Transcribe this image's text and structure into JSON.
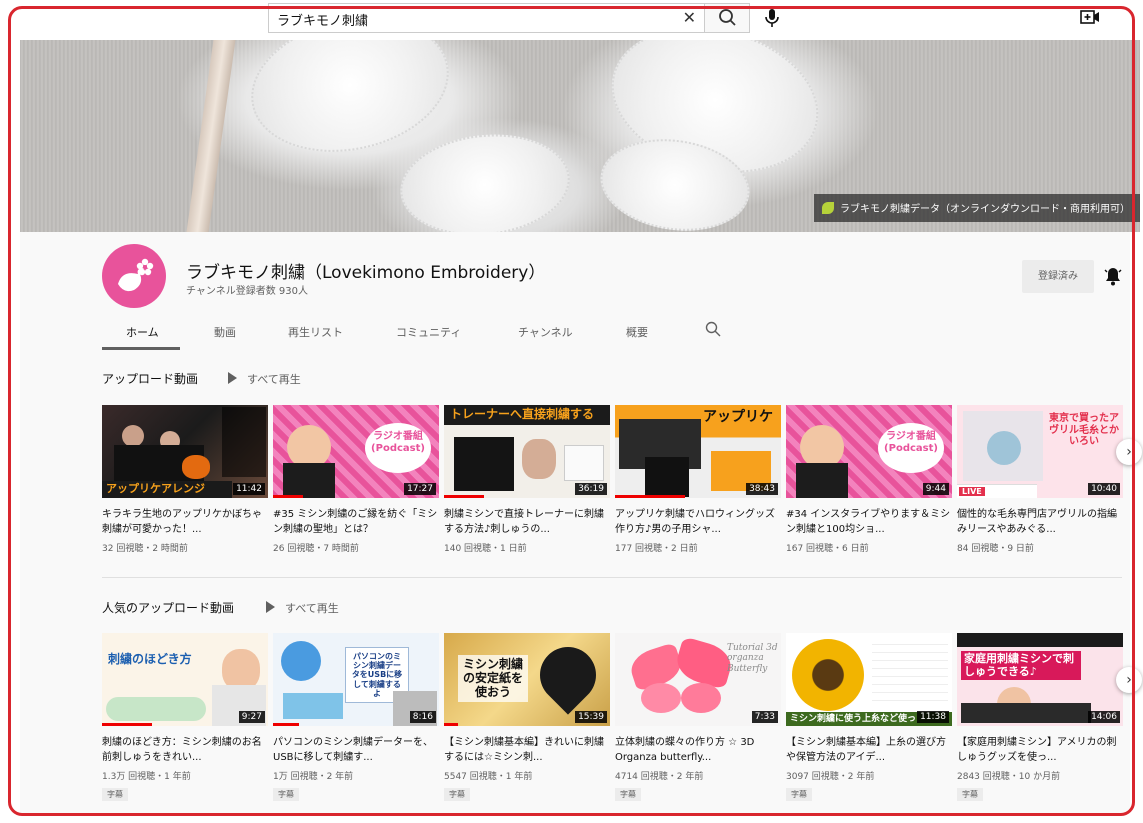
{
  "search": {
    "value": "ラブキモノ刺繍",
    "clear_icon": "close-icon",
    "search_icon": "search-icon",
    "mic_icon": "mic-icon",
    "create_icon": "video-add-icon"
  },
  "banner": {
    "link_text": "ラブキモノ刺繍データ（オンラインダウンロード・商用利用可）"
  },
  "channel": {
    "name": "ラブキモノ刺繍（Lovekimono Embroidery）",
    "subscribers": "チャンネル登録者数 930人",
    "subscribe_label": "登録済み",
    "avatar_color": "#e8539b"
  },
  "tabs": [
    {
      "label": "ホーム",
      "active": true
    },
    {
      "label": "動画"
    },
    {
      "label": "再生リスト"
    },
    {
      "label": "コミュニティ"
    },
    {
      "label": "チャンネル"
    },
    {
      "label": "概要"
    }
  ],
  "shelves": [
    {
      "title": "アップロード動画",
      "play_all": "すべて再生",
      "videos": [
        {
          "title": "キラキラ生地のアップリケかぼちゃ刺繍が可愛かった！...",
          "meta": "32 回視聴・2 時間前",
          "duration": "11:42",
          "caption": "アップリケアレンジ"
        },
        {
          "title": "#35 ミシン刺繍のご縁を紡ぐ「ミシン刺繍の聖地」とは？",
          "meta": "26 回視聴・7 時間前",
          "duration": "17:27",
          "caption": "ラジオ番組(Podcast)"
        },
        {
          "title": "刺繍ミシンで直接トレーナーに刺繍する方法♪刺しゅうの...",
          "meta": "140 回視聴・1 日前",
          "duration": "36:19",
          "caption": "トレーナーへ直接刺繍する"
        },
        {
          "title": "アップリケ刺繍でハロウィングッズ作り方♪男の子用シャ...",
          "meta": "177 回視聴・2 日前",
          "duration": "38:43",
          "caption": "アップリケ"
        },
        {
          "title": "#34 インスタライブやります＆ミシン刺繍と100均ショ...",
          "meta": "167 回視聴・6 日前",
          "duration": "9:44",
          "caption": "ラジオ番組(Podcast)"
        },
        {
          "title": "個性的な毛糸専門店アヴリルの指編みリースやあみぐる...",
          "meta": "84 回視聴・9 日前",
          "duration": "10:40",
          "caption": "東京で買ったアヴリル毛糸とかいろい"
        }
      ]
    },
    {
      "title": "人気のアップロード動画",
      "play_all": "すべて再生",
      "videos": [
        {
          "title": "刺繍のほどき方：ミシン刺繍のお名前刺しゅうをきれい...",
          "meta": "1.3万 回視聴・1 年前",
          "duration": "9:27",
          "caption": "刺繍のほどき方",
          "badge": "字幕"
        },
        {
          "title": "パソコンのミシン刺繍データーを、USBに移して刺繍す...",
          "meta": "1万 回視聴・2 年前",
          "duration": "8:16",
          "caption": "パソコンのミシン刺繍データをUSBに移して刺繍するよ",
          "badge": "字幕"
        },
        {
          "title": "【ミシン刺繍基本編】きれいに刺繍するには☆ミシン刺...",
          "meta": "5547 回視聴・1 年前",
          "duration": "15:39",
          "caption": "ミシン刺繍の安定紙を使おう",
          "badge": "字幕"
        },
        {
          "title": "立体刺繍の蝶々の作り方 ☆ 3D Organza butterfly...",
          "meta": "4714 回視聴・2 年前",
          "duration": "7:33",
          "caption": "Tutorial 3d organza Butterfly",
          "badge": "字幕"
        },
        {
          "title": "【ミシン刺繍基本編】上糸の選び方や保管方法のアイデ...",
          "meta": "3097 回視聴・2 年前",
          "duration": "11:38",
          "caption": "ミシン刺繍に使う上糸など使っ",
          "badge": "字幕"
        },
        {
          "title": "【家庭用刺繍ミシン】アメリカの刺しゅうグッズを使っ...",
          "meta": "2843 回視聴・10 か月前",
          "duration": "14:06",
          "caption": "家庭用刺繍ミシンで刺しゅうできる♪",
          "badge": "字幕"
        }
      ]
    }
  ]
}
